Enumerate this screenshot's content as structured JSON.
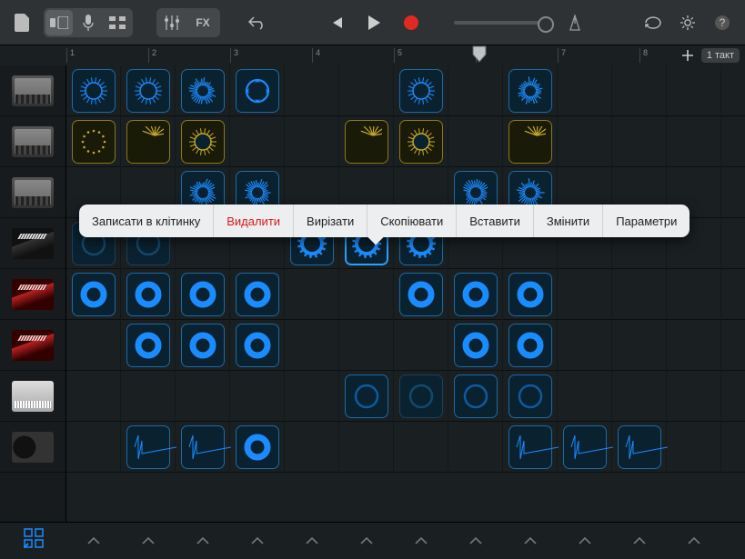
{
  "toolbar": {
    "bars_label": "1 такт"
  },
  "ruler": {
    "ticks": [
      1,
      2,
      3,
      4,
      5,
      6,
      7,
      8
    ],
    "playhead_col": 5.6
  },
  "context_menu": {
    "items": [
      {
        "label": "Записати в клітинку",
        "key": "record",
        "red": false
      },
      {
        "label": "Видалити",
        "key": "delete",
        "red": true
      },
      {
        "label": "Вирізати",
        "key": "cut",
        "red": false
      },
      {
        "label": "Скопіювати",
        "key": "copy",
        "red": false
      },
      {
        "label": "Вставити",
        "key": "paste",
        "red": false
      },
      {
        "label": "Змінити",
        "key": "edit",
        "red": false
      },
      {
        "label": "Параметри",
        "key": "settings",
        "red": false
      }
    ]
  },
  "cols": 12,
  "tracks": [
    {
      "thumb": "drum"
    },
    {
      "thumb": "drum"
    },
    {
      "thumb": "drum"
    },
    {
      "thumb": "keys"
    },
    {
      "thumb": "red"
    },
    {
      "thumb": "red"
    },
    {
      "thumb": "synth"
    },
    {
      "thumb": "dj"
    }
  ],
  "cells": [
    {
      "r": 0,
      "c": 0,
      "color": "blue",
      "shape": "ringspike"
    },
    {
      "r": 0,
      "c": 1,
      "color": "blue",
      "shape": "ringspike"
    },
    {
      "r": 0,
      "c": 2,
      "color": "blue",
      "shape": "burst"
    },
    {
      "r": 0,
      "c": 3,
      "color": "blue",
      "shape": "arrows"
    },
    {
      "r": 0,
      "c": 6,
      "color": "blue",
      "shape": "ringspike"
    },
    {
      "r": 0,
      "c": 8,
      "color": "blue",
      "shape": "burst"
    },
    {
      "r": 1,
      "c": 0,
      "color": "yellow",
      "shape": "dots"
    },
    {
      "r": 1,
      "c": 1,
      "color": "yellow",
      "shape": "sparks"
    },
    {
      "r": 1,
      "c": 2,
      "color": "yellow",
      "shape": "ringspike"
    },
    {
      "r": 1,
      "c": 5,
      "color": "yellow",
      "shape": "sparks"
    },
    {
      "r": 1,
      "c": 6,
      "color": "yellow",
      "shape": "ringspike"
    },
    {
      "r": 1,
      "c": 8,
      "color": "yellow",
      "shape": "sparks"
    },
    {
      "r": 2,
      "c": 2,
      "color": "blue",
      "shape": "burst"
    },
    {
      "r": 2,
      "c": 3,
      "color": "blue",
      "shape": "burst"
    },
    {
      "r": 2,
      "c": 7,
      "color": "blue",
      "shape": "burst"
    },
    {
      "r": 2,
      "c": 8,
      "color": "blue",
      "shape": "burst"
    },
    {
      "r": 3,
      "c": 0,
      "color": "empty",
      "shape": "circle"
    },
    {
      "r": 3,
      "c": 1,
      "color": "empty",
      "shape": "circle"
    },
    {
      "r": 3,
      "c": 4,
      "color": "blue",
      "shape": "gear"
    },
    {
      "r": 3,
      "c": 5,
      "color": "blue",
      "shape": "gear",
      "selected": true
    },
    {
      "r": 3,
      "c": 6,
      "color": "blue",
      "shape": "gear"
    },
    {
      "r": 4,
      "c": 0,
      "color": "blue",
      "shape": "thickring"
    },
    {
      "r": 4,
      "c": 1,
      "color": "blue",
      "shape": "thickring"
    },
    {
      "r": 4,
      "c": 2,
      "color": "blue",
      "shape": "thickring"
    },
    {
      "r": 4,
      "c": 3,
      "color": "blue",
      "shape": "thickring"
    },
    {
      "r": 4,
      "c": 6,
      "color": "blue",
      "shape": "thickring"
    },
    {
      "r": 4,
      "c": 7,
      "color": "blue",
      "shape": "thickring"
    },
    {
      "r": 4,
      "c": 8,
      "color": "blue",
      "shape": "thickring"
    },
    {
      "r": 5,
      "c": 1,
      "color": "blue",
      "shape": "thickring"
    },
    {
      "r": 5,
      "c": 2,
      "color": "blue",
      "shape": "thickring"
    },
    {
      "r": 5,
      "c": 3,
      "color": "blue",
      "shape": "thickring"
    },
    {
      "r": 5,
      "c": 7,
      "color": "blue",
      "shape": "thickring"
    },
    {
      "r": 5,
      "c": 8,
      "color": "blue",
      "shape": "thickring"
    },
    {
      "r": 6,
      "c": 5,
      "color": "blue",
      "shape": "circle"
    },
    {
      "r": 6,
      "c": 6,
      "color": "empty",
      "shape": "circle"
    },
    {
      "r": 6,
      "c": 7,
      "color": "blue",
      "shape": "circle"
    },
    {
      "r": 6,
      "c": 8,
      "color": "blue",
      "shape": "circle"
    },
    {
      "r": 7,
      "c": 1,
      "color": "blue",
      "shape": "waveL"
    },
    {
      "r": 7,
      "c": 2,
      "color": "blue",
      "shape": "waveL"
    },
    {
      "r": 7,
      "c": 3,
      "color": "blue",
      "shape": "thickring"
    },
    {
      "r": 7,
      "c": 8,
      "color": "blue",
      "shape": "waveL"
    },
    {
      "r": 7,
      "c": 9,
      "color": "blue",
      "shape": "waveL"
    },
    {
      "r": 7,
      "c": 10,
      "color": "blue",
      "shape": "waveL"
    }
  ]
}
